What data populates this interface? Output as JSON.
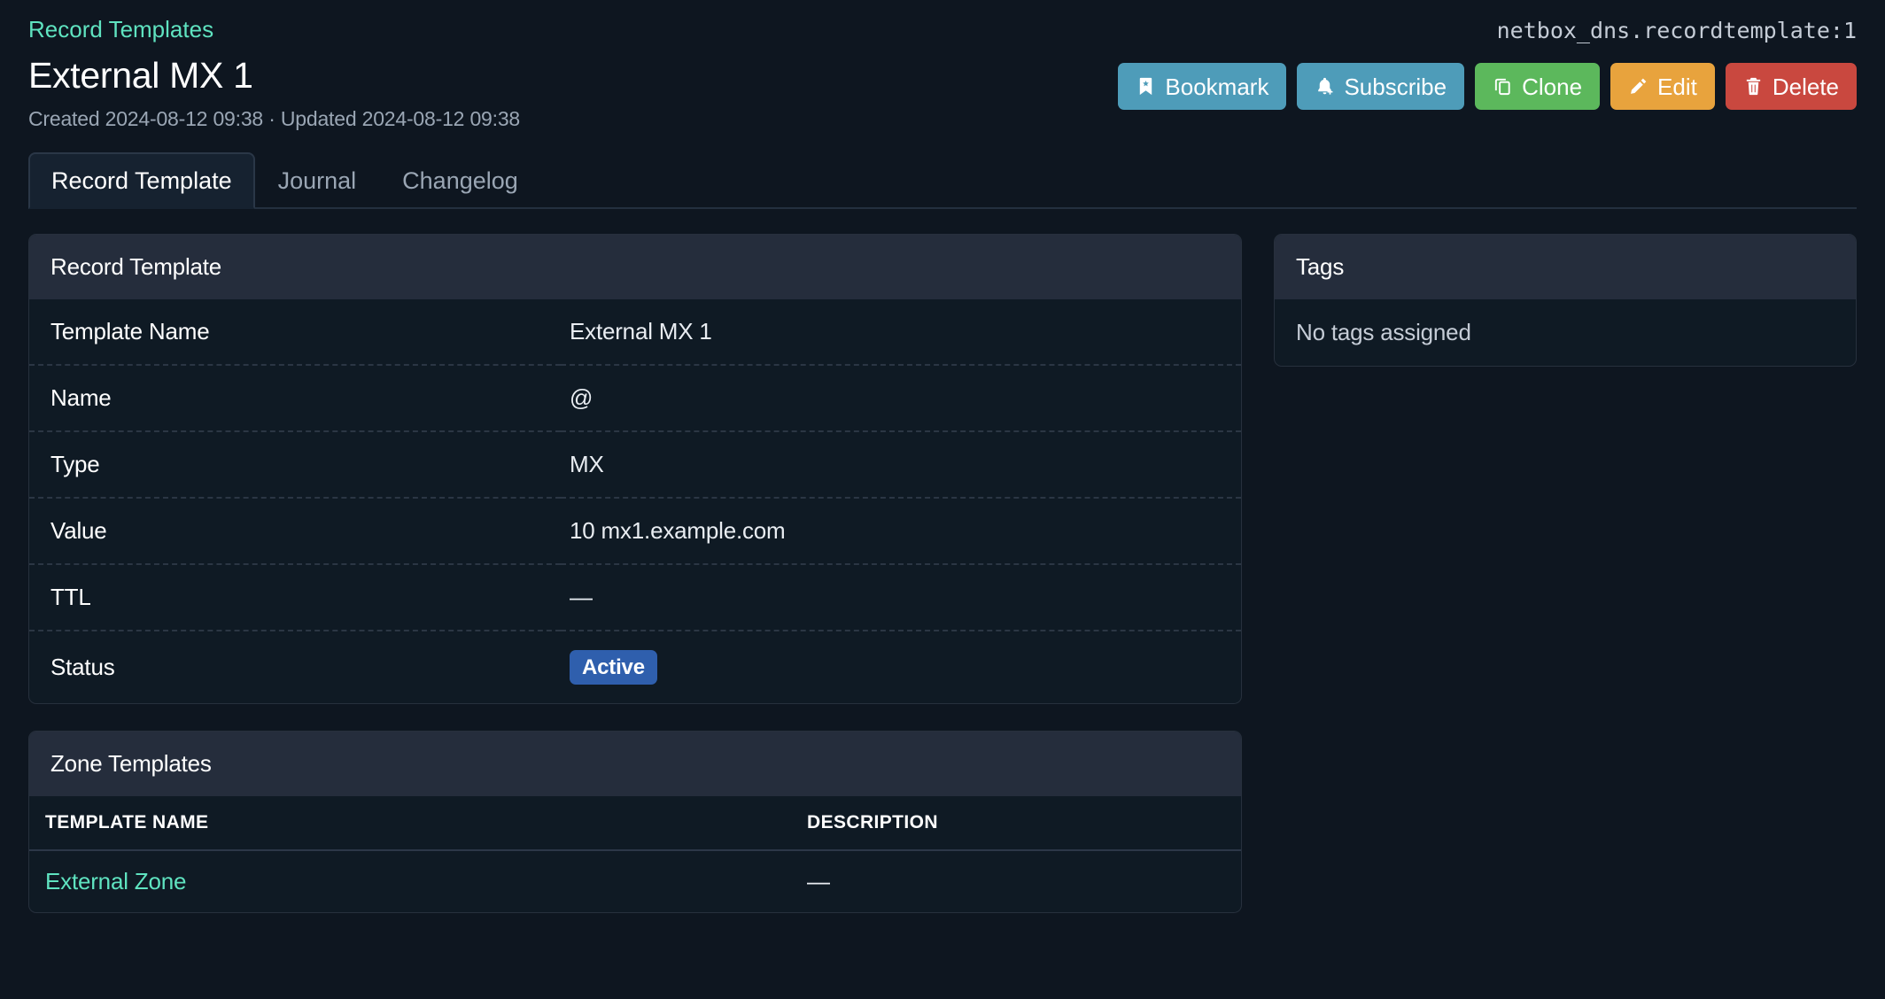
{
  "header": {
    "breadcrumb": "Record Templates",
    "title": "External MX 1",
    "meta": "Created 2024-08-12 09:38 · Updated 2024-08-12 09:38",
    "object_id": "netbox_dns.recordtemplate:1"
  },
  "actions": [
    {
      "label": "Bookmark",
      "icon": "bookmark-icon",
      "color": "#4e9cb9"
    },
    {
      "label": "Subscribe",
      "icon": "bell-plus-icon",
      "color": "#4e9cb9"
    },
    {
      "label": "Clone",
      "icon": "copy-icon",
      "color": "#5cb85c"
    },
    {
      "label": "Edit",
      "icon": "pencil-icon",
      "color": "#e8a33d"
    },
    {
      "label": "Delete",
      "icon": "trash-icon",
      "color": "#c9483f"
    }
  ],
  "tabs": [
    {
      "label": "Record Template",
      "active": true
    },
    {
      "label": "Journal",
      "active": false
    },
    {
      "label": "Changelog",
      "active": false
    }
  ],
  "record_template_card": {
    "title": "Record Template",
    "rows": [
      {
        "label": "Template Name",
        "value": "External MX 1"
      },
      {
        "label": "Name",
        "value": "@"
      },
      {
        "label": "Type",
        "value": "MX"
      },
      {
        "label": "Value",
        "value": "10 mx1.example.com"
      },
      {
        "label": "TTL",
        "value": "—"
      },
      {
        "label": "Status",
        "value": "Active"
      }
    ]
  },
  "tags_card": {
    "title": "Tags",
    "empty_text": "No tags assigned"
  },
  "zone_templates_card": {
    "title": "Zone Templates",
    "columns": [
      "TEMPLATE NAME",
      "DESCRIPTION"
    ],
    "rows": [
      {
        "name": "External Zone",
        "description": "—"
      }
    ]
  },
  "colors": {
    "link": "#5fe3c0",
    "status_active": "#2f5fad",
    "page_bg": "#0e1620",
    "card_header_bg": "#252d3c",
    "card_body_bg": "#0f1a24"
  }
}
